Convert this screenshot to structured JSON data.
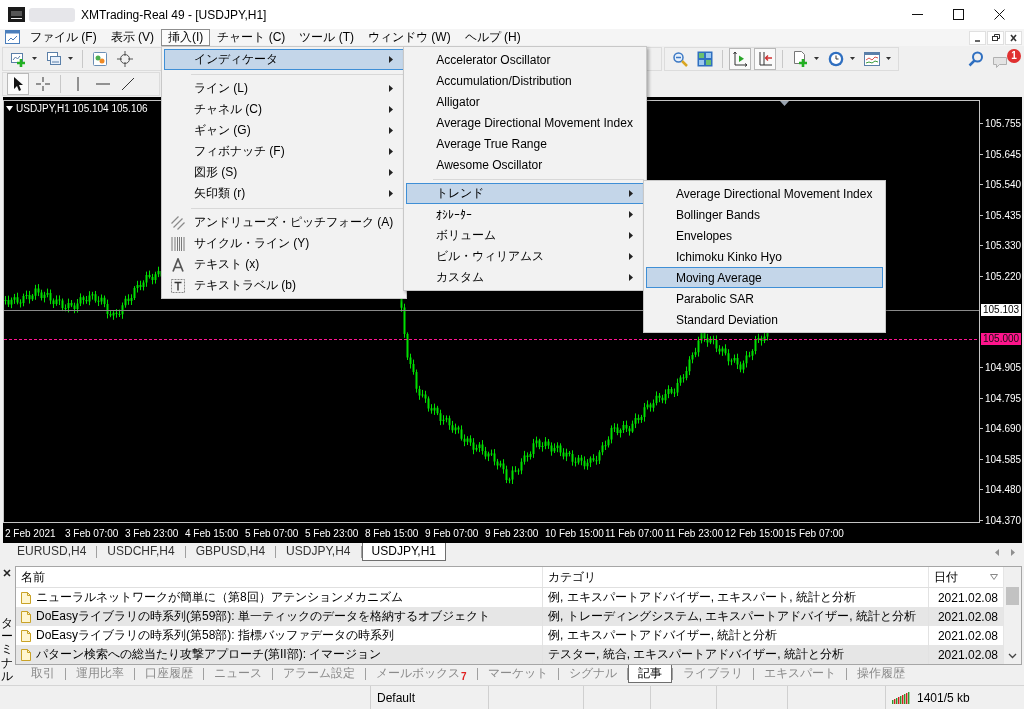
{
  "window": {
    "title": "XMTrading-Real 49 - [USDJPY,H1]"
  },
  "menu_bar": [
    {
      "label": "ファイル (F)",
      "selected": false
    },
    {
      "label": "表示 (V)",
      "selected": false
    },
    {
      "label": "挿入(I)",
      "selected": true,
      "menu": {
        "groups": [
          [
            {
              "label": "インディケータ",
              "kind": "submenu",
              "selected": true,
              "submenu": {
                "groups": [
                  [
                    {
                      "label": "Accelerator Oscillator",
                      "kind": "command",
                      "selected": false
                    },
                    {
                      "label": "Accumulation/Distribution",
                      "kind": "command",
                      "selected": false
                    },
                    {
                      "label": "Alligator",
                      "kind": "command",
                      "selected": false
                    },
                    {
                      "label": "Average Directional Movement Index",
                      "kind": "command",
                      "selected": false
                    },
                    {
                      "label": "Average True Range",
                      "kind": "command",
                      "selected": false
                    },
                    {
                      "label": "Awesome Oscillator",
                      "kind": "command",
                      "selected": false
                    }
                  ],
                  [
                    {
                      "label": "トレンド",
                      "kind": "submenu",
                      "selected": true,
                      "submenu": {
                        "groups": [
                          [
                            {
                              "label": "Average Directional Movement Index",
                              "kind": "command",
                              "selected": false
                            },
                            {
                              "label": "Bollinger Bands",
                              "kind": "command",
                              "selected": false
                            },
                            {
                              "label": "Envelopes",
                              "kind": "command",
                              "selected": false
                            },
                            {
                              "label": "Ichimoku Kinko Hyo",
                              "kind": "command",
                              "selected": false
                            },
                            {
                              "label": "Moving Average",
                              "kind": "command",
                              "selected": true
                            },
                            {
                              "label": "Parabolic SAR",
                              "kind": "command",
                              "selected": false
                            },
                            {
                              "label": "Standard Deviation",
                              "kind": "command",
                              "selected": false
                            }
                          ]
                        ]
                      }
                    },
                    {
                      "label": "ｵｼﾚｰﾀｰ",
                      "kind": "submenu",
                      "selected": false
                    },
                    {
                      "label": "ボリューム",
                      "kind": "submenu",
                      "selected": false
                    },
                    {
                      "label": "ビル・ウィリアムス",
                      "kind": "submenu",
                      "selected": false
                    },
                    {
                      "label": "カスタム",
                      "kind": "submenu",
                      "selected": false
                    }
                  ]
                ]
              }
            }
          ],
          [
            {
              "label": "ライン (L)",
              "kind": "submenu",
              "selected": false
            },
            {
              "label": "チャネル (C)",
              "kind": "submenu",
              "selected": false
            },
            {
              "label": "ギャン (G)",
              "kind": "submenu",
              "selected": false
            },
            {
              "label": "フィボナッチ (F)",
              "kind": "submenu",
              "selected": false
            },
            {
              "label": "図形 (S)",
              "kind": "submenu",
              "selected": false
            },
            {
              "label": "矢印類 (r)",
              "kind": "submenu",
              "selected": false
            }
          ],
          [
            {
              "label": "アンドリューズ・ピッチフォーク (A)",
              "kind": "tool",
              "selected": false
            },
            {
              "label": "サイクル・ライン (Y)",
              "kind": "tool",
              "selected": false
            },
            {
              "label": "テキスト (x)",
              "kind": "tool",
              "selected": false
            },
            {
              "label": "テキストラベル (b)",
              "kind": "tool",
              "selected": false
            }
          ]
        ]
      }
    },
    {
      "label": "チャート (C)",
      "selected": false
    },
    {
      "label": "ツール (T)",
      "selected": false
    },
    {
      "label": "ウィンドウ (W)",
      "selected": false
    },
    {
      "label": "ヘルプ (H)",
      "selected": false
    }
  ],
  "main_toolbar": {
    "toggles": [
      {
        "on": true
      },
      {
        "on": true
      }
    ],
    "notification_badge": "1"
  },
  "drawing_toolbar": {
    "tools": [
      {
        "selected": true
      },
      {
        "selected": false
      },
      {
        "selected": false
      },
      {
        "selected": false
      },
      {
        "selected": false
      }
    ]
  },
  "chart": {
    "header": "USDJPY,H1 105.104 105.106",
    "price_ticks": [
      "105.755",
      "105.645",
      "105.540",
      "105.435",
      "105.330",
      "105.220",
      "104.905",
      "104.795",
      "104.690",
      "104.585",
      "104.480",
      "104.370"
    ],
    "bid_price": "105.103",
    "level_price": "105.000",
    "time_ticks": [
      "2 Feb 2021",
      "3 Feb 07:00",
      "3 Feb 23:00",
      "4 Feb 15:00",
      "5 Feb 07:00",
      "5 Feb 23:00",
      "8 Feb 15:00",
      "9 Feb 07:00",
      "9 Feb 23:00",
      "10 Feb 15:00",
      "11 Feb 07:00",
      "11 Feb 23:00",
      "12 Feb 15:00",
      "15 Feb 07:00"
    ]
  },
  "chart_tabs": [
    {
      "label": "EURUSD,H4",
      "selected": false
    },
    {
      "label": "USDCHF,H4",
      "selected": false
    },
    {
      "label": "GBPUSD,H4",
      "selected": false
    },
    {
      "label": "USDJPY,H4",
      "selected": false
    },
    {
      "label": "USDJPY,H1",
      "selected": true
    }
  ],
  "terminal": {
    "title": "ターミナル",
    "columns": [
      "名前",
      "カテゴリ",
      "日付"
    ],
    "rows": [
      {
        "name": "ニューラルネットワークが簡単に（第8回）アテンションメカニズム",
        "category": "例, エキスパートアドバイザー, エキスパート, 統計と分析",
        "date": "2021.02.08",
        "selected": false
      },
      {
        "name": "DoEasyライブラリの時系列(第59部): 単一ティックのデータを格納するオブジェクト",
        "category": "例, トレーディングシステム, エキスパートアドバイザー, 統計と分析",
        "date": "2021.02.08",
        "selected": false
      },
      {
        "name": "DoEasyライブラリの時系列(第58部): 指標バッファデータの時系列",
        "category": "例, エキスパートアドバイザー, 統計と分析",
        "date": "2021.02.08",
        "selected": false
      },
      {
        "name": "パターン検索への総当たり攻撃アプローチ(第II部): イマージョン",
        "category": "テスター, 統合, エキスパートアドバイザー, 統計と分析",
        "date": "2021.02.08",
        "selected": false
      }
    ],
    "tabs": [
      {
        "label": "取引",
        "selected": false
      },
      {
        "label": "運用比率",
        "selected": false
      },
      {
        "label": "口座履歴",
        "selected": false
      },
      {
        "label": "ニュース",
        "selected": false
      },
      {
        "label": "アラーム設定",
        "selected": false
      },
      {
        "label": "メールボックス",
        "badge": "7",
        "selected": false
      },
      {
        "label": "マーケット",
        "selected": false
      },
      {
        "label": "シグナル",
        "selected": false
      },
      {
        "label": "記事",
        "selected": true
      },
      {
        "label": "ライブラリ",
        "selected": false
      },
      {
        "label": "エキスパート",
        "selected": false
      },
      {
        "label": "操作履歴",
        "selected": false
      }
    ]
  },
  "status_bar": {
    "profile": "Default",
    "traffic": "1401/5 kb"
  }
}
